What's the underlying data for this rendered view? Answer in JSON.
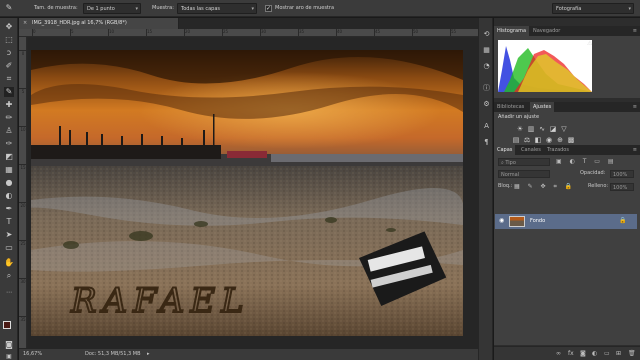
{
  "options_bar": {
    "sample_size_label": "Tam. de muestra:",
    "sample_size_value": "De 1 punto",
    "sample_label": "Muestra:",
    "sample_value": "Todas las capas",
    "show_ring_label": "Mostrar aro de muestra",
    "show_ring_checked": "✓",
    "workspace_value": "Fotografía"
  },
  "document": {
    "tab_title": "IMG_3918_HDR.jpg al 16,7% (RGB/8*)",
    "close_glyph": "×",
    "ruler_ticks_top": [
      "0",
      "5",
      "10",
      "15",
      "20",
      "25",
      "30",
      "35",
      "40",
      "45",
      "50",
      "55"
    ],
    "ruler_ticks_left": [
      "0",
      "5",
      "10",
      "15",
      "20",
      "25",
      "30",
      "35"
    ],
    "sand_text": "RAFAEL"
  },
  "status_bar": {
    "zoom": "16,67%",
    "doc_info": "Doc: 51,3 MB/51,3 MB"
  },
  "histogram_panel": {
    "tabs": [
      "Histograma",
      "Navegador"
    ],
    "warning_glyph": "⚠"
  },
  "adjustments_panel": {
    "tabs": [
      "Bibliotecas",
      "Ajustes"
    ],
    "add_adjustment_label": "Añadir un ajuste"
  },
  "layers_panel": {
    "tabs": [
      "Capas",
      "Canales",
      "Trazados"
    ],
    "filter_placeholder": "Tipo",
    "blend_mode": "Normal",
    "opacity_label": "Opacidad:",
    "opacity_value": "100%",
    "lock_label": "Bloq.:",
    "fill_label": "Relleno:",
    "fill_value": "100%",
    "layers": [
      {
        "name": "Fondo",
        "visible": true,
        "locked": true
      }
    ]
  },
  "colors": {
    "app_bg": "#3b3b3b",
    "panel_bg": "#404040",
    "selected_layer": "#5b6c8a",
    "foreground_swatch": "#4a1a14",
    "background_swatch": "#ffffff"
  }
}
